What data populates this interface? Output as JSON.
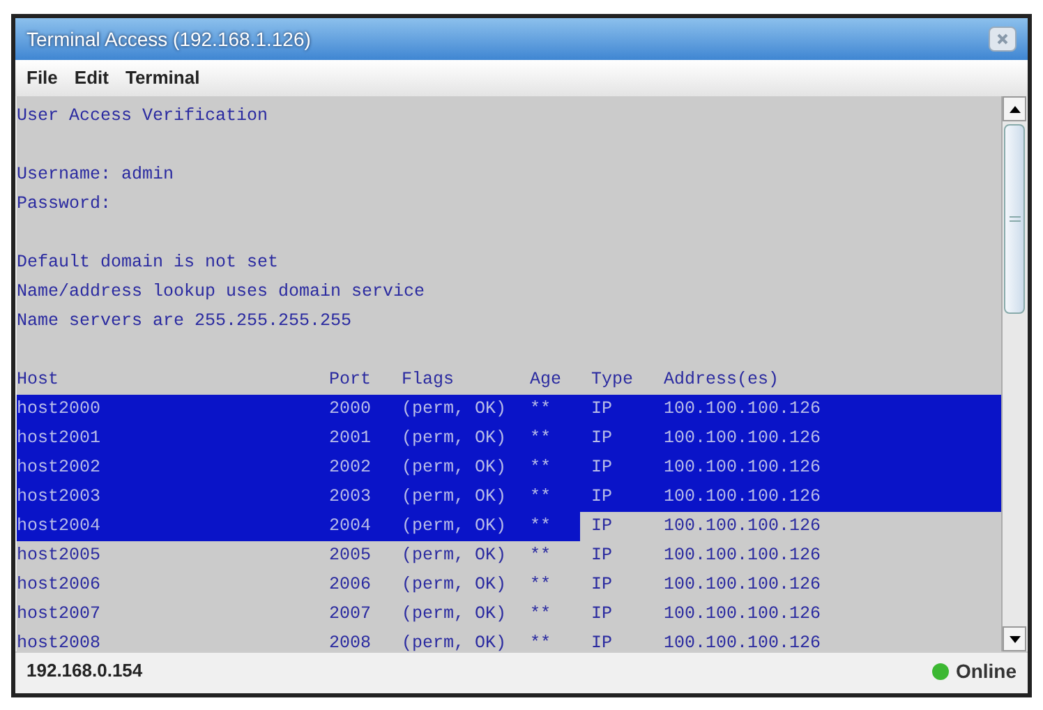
{
  "window": {
    "title": "Terminal Access (192.168.1.126)"
  },
  "menu": [
    "File",
    "Edit",
    "Terminal"
  ],
  "terminal": {
    "blocks": [
      [
        "User Access Verification"
      ],
      [
        "Username: admin",
        "Password:"
      ],
      [
        "Default domain is not set",
        "Name/address lookup uses domain service",
        "Name servers are 255.255.255.255"
      ]
    ],
    "table": {
      "columns": [
        "Host",
        "Port",
        "Flags",
        "Age",
        "Type",
        "Address(es)"
      ],
      "rows": [
        {
          "cells": [
            {
              "text": "host2000",
              "selected": true
            },
            {
              "text": "2000",
              "selected": true
            },
            {
              "text": "(perm, OK)",
              "selected": true
            },
            {
              "text": "**",
              "selected": true
            },
            {
              "text": "IP",
              "selected": true
            },
            {
              "text": "100.100.100.126",
              "selected": true
            }
          ]
        },
        {
          "cells": [
            {
              "text": "host2001",
              "selected": true
            },
            {
              "text": "2001",
              "selected": true
            },
            {
              "text": "(perm, OK)",
              "selected": true
            },
            {
              "text": "**",
              "selected": true
            },
            {
              "text": "IP",
              "selected": true
            },
            {
              "text": "100.100.100.126",
              "selected": true
            }
          ]
        },
        {
          "cells": [
            {
              "text": "host2002",
              "selected": true
            },
            {
              "text": "2002",
              "selected": true
            },
            {
              "text": "(perm, OK)",
              "selected": true
            },
            {
              "text": "**",
              "selected": true
            },
            {
              "text": "IP",
              "selected": true
            },
            {
              "text": "100.100.100.126",
              "selected": true
            }
          ]
        },
        {
          "cells": [
            {
              "text": "host2003",
              "selected": true
            },
            {
              "text": "2003",
              "selected": true
            },
            {
              "text": "(perm, OK)",
              "selected": true
            },
            {
              "text": "**",
              "selected": true
            },
            {
              "text": "IP",
              "selected": true
            },
            {
              "text": "100.100.100.126",
              "selected": true
            }
          ]
        },
        {
          "cells": [
            {
              "text": "host2004",
              "selected": true
            },
            {
              "text": "2004",
              "selected": true
            },
            {
              "text": "(perm, OK)",
              "selected": true
            },
            {
              "text": "**",
              "selected": true
            },
            {
              "text": "IP",
              "selected": false
            },
            {
              "text": "100.100.100.126",
              "selected": false
            }
          ]
        },
        {
          "cells": [
            {
              "text": "host2005",
              "selected": false
            },
            {
              "text": "2005",
              "selected": false
            },
            {
              "text": "(perm, OK)",
              "selected": false
            },
            {
              "text": "**",
              "selected": false
            },
            {
              "text": "IP",
              "selected": false
            },
            {
              "text": "100.100.100.126",
              "selected": false
            }
          ]
        },
        {
          "cells": [
            {
              "text": "host2006",
              "selected": false
            },
            {
              "text": "2006",
              "selected": false
            },
            {
              "text": "(perm, OK)",
              "selected": false
            },
            {
              "text": "**",
              "selected": false
            },
            {
              "text": "IP",
              "selected": false
            },
            {
              "text": "100.100.100.126",
              "selected": false
            }
          ]
        },
        {
          "cells": [
            {
              "text": "host2007",
              "selected": false
            },
            {
              "text": "2007",
              "selected": false
            },
            {
              "text": "(perm, OK)",
              "selected": false
            },
            {
              "text": "**",
              "selected": false
            },
            {
              "text": "IP",
              "selected": false
            },
            {
              "text": "100.100.100.126",
              "selected": false
            }
          ]
        },
        {
          "cells": [
            {
              "text": "host2008",
              "selected": false
            },
            {
              "text": "2008",
              "selected": false
            },
            {
              "text": "(perm, OK)",
              "selected": false
            },
            {
              "text": "**",
              "selected": false
            },
            {
              "text": "IP",
              "selected": false
            },
            {
              "text": "100.100.100.126",
              "selected": false
            }
          ]
        }
      ]
    }
  },
  "status_bar": {
    "address": "192.168.0.154",
    "connection": {
      "label": "Online",
      "online": true
    }
  }
}
